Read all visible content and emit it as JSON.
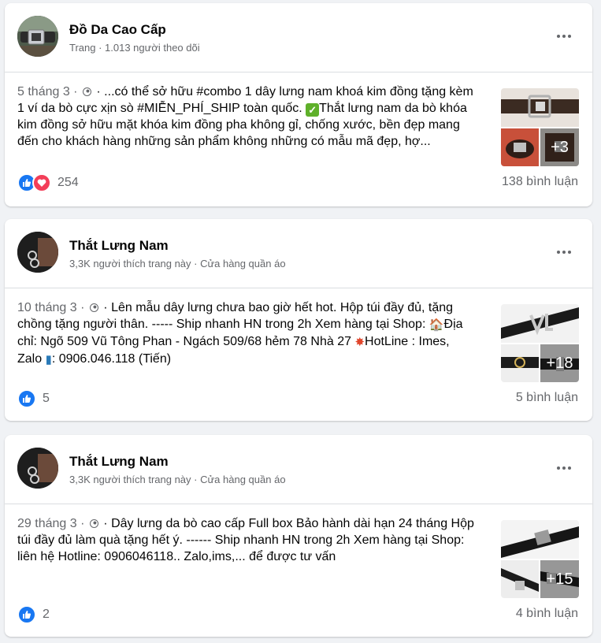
{
  "posts": [
    {
      "page_name": "Đồ Da Cao Cấp",
      "subtitle": "Trang · 1.013 người theo dõi",
      "date": "5 tháng 3 ·",
      "text_before_emoji": " · ...có thể sở hữu #combo 1 dây lưng nam khoá kim đồng tặng kèm 1 ví da bò cực xịn sò #MIỄN_PHÍ_SHIP toàn quốc. ",
      "text_after_emoji": "Thắt lưng nam da bò khóa kim đồng sở hữu mặt khóa kim đồng pha không gỉ, chống xước, bền đẹp mang đến cho khách hàng những sản phẩm không những có mẫu mã đẹp, hợ...",
      "reactions": "254",
      "comments": "138 bình luận",
      "more_photos": "+3"
    },
    {
      "page_name": "Thắt Lưng Nam",
      "subtitle": "3,3K người thích trang này · Cửa hàng quần áo",
      "date": "10 tháng 3 ·",
      "text_part1": " · Lên mẫu dây lưng chưa bao giờ hết hot. Hộp túi đầy đủ, tặng chồng tặng người thân. ----- Ship nhanh HN trong 2h Xem hàng tại Shop: ",
      "text_part2": "Địa chỉ: Ngõ 509 Vũ Tông Phan - Ngách 509/68 hẻm 78 Nhà 27 ",
      "text_part3": "HotLine : Imes, Zalo ",
      "text_part4": ": 0906.046.118 (Tiến)",
      "reactions": "5",
      "comments": "5 bình luận",
      "more_photos": "+18"
    },
    {
      "page_name": "Thắt Lưng Nam",
      "subtitle": "3,3K người thích trang này · Cửa hàng quần áo",
      "date": "29 tháng 3 ·",
      "text": " · Dây lưng da bò cao cấp Full box Bảo hành dài hạn 24 tháng Hộp túi đầy đủ làm quà tặng hết ý. ------ Ship nhanh HN trong 2h Xem hàng tại Shop: liên hệ Hotline: 0906046118.. Zalo,ims,... để được tư vấn",
      "reactions": "2",
      "comments": "4 bình luận",
      "more_photos": "+15"
    }
  ],
  "colors": {
    "like": "#1877f2",
    "love": "#f33e58",
    "secondary_text": "#65676b"
  },
  "icons": [
    "globe-icon",
    "more-options-icon",
    "like-icon",
    "love-icon",
    "check-emoji",
    "house-emoji",
    "collision-emoji",
    "phone-emoji"
  ]
}
